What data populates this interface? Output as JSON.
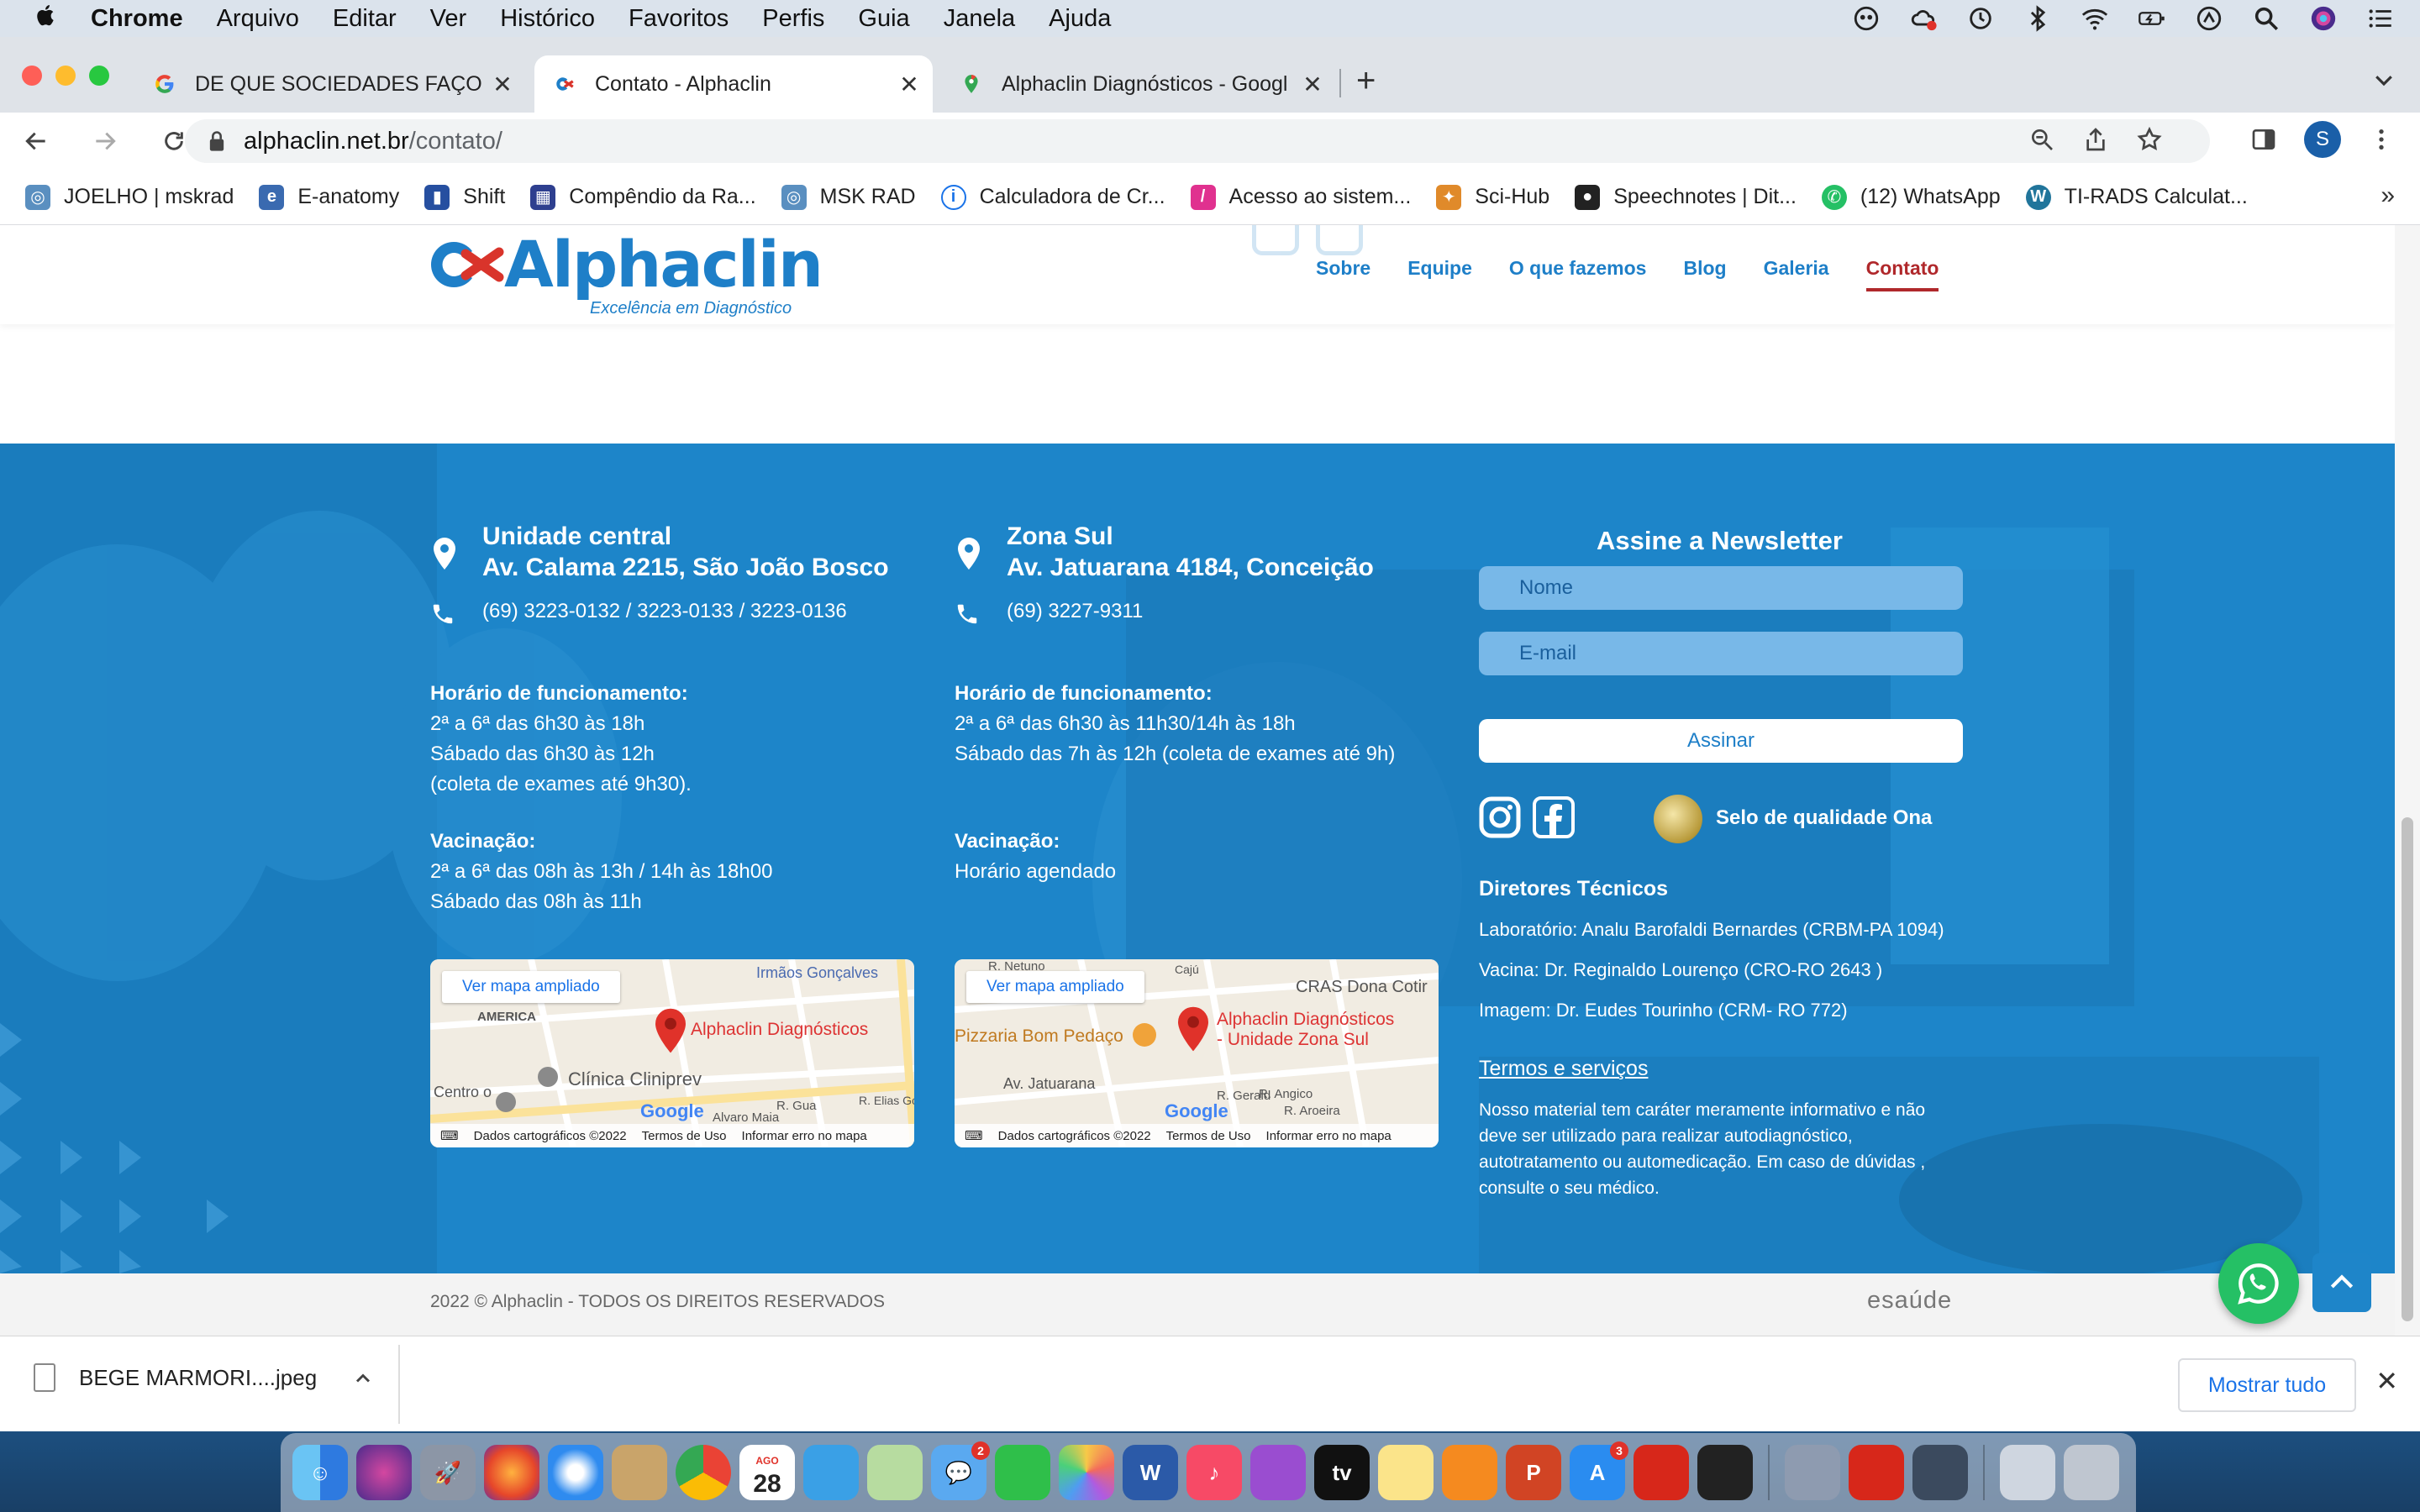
{
  "menubar": {
    "app": "Chrome",
    "items": [
      "Arquivo",
      "Editar",
      "Ver",
      "Histórico",
      "Favoritos",
      "Perfis",
      "Guia",
      "Janela",
      "Ajuda"
    ]
  },
  "tabs": [
    {
      "title": "DE QUE SOCIEDADES FAÇO PA",
      "favicon": "google-icon"
    },
    {
      "title": "Contato - Alphaclin",
      "favicon": "alphaclin-icon",
      "active": true
    },
    {
      "title": "Alphaclin Diagnósticos - Googl",
      "favicon": "google-maps-icon"
    }
  ],
  "address": {
    "host": "alphaclin.net.br",
    "path": "/contato/"
  },
  "profile_initial": "S",
  "bookmarks": [
    {
      "label": "JOELHO | mskrad",
      "icon": "mskrad-icon",
      "color": "#5a8fc0"
    },
    {
      "label": "E-anatomy",
      "icon": "e-anatomy-icon",
      "color": "#3a6ab0"
    },
    {
      "label": "Shift",
      "icon": "shift-icon",
      "color": "#264fa0"
    },
    {
      "label": "Compêndio da Ra...",
      "icon": "compendio-icon",
      "color": "#2e3f8f"
    },
    {
      "label": "MSK RAD",
      "icon": "msk-rad-icon",
      "color": "#5a8fc0"
    },
    {
      "label": "Calculadora de Cr...",
      "icon": "calculadora-icon",
      "color": "#1a73e8"
    },
    {
      "label": "Acesso ao sistem...",
      "icon": "acesso-icon",
      "color": "#e0318f"
    },
    {
      "label": "Sci-Hub",
      "icon": "sci-hub-icon",
      "color": "#e08a2a"
    },
    {
      "label": "Speechnotes | Dit...",
      "icon": "microphone-icon",
      "color": "#222222"
    },
    {
      "label": "(12) WhatsApp",
      "icon": "whatsapp-icon",
      "color": "#25c065"
    },
    {
      "label": "TI-RADS Calculat...",
      "icon": "wordpress-icon",
      "color": "#21759b"
    }
  ],
  "site": {
    "logo_name": "Alphaclin",
    "logo_tagline": "Excelência em Diagnóstico",
    "nav": [
      "Sobre",
      "Equipe",
      "O que fazemos",
      "Blog",
      "Galeria",
      "Contato"
    ],
    "nav_active": "Contato"
  },
  "footer": {
    "unit1": {
      "title1": "Unidade central",
      "title2": "Av. Calama 2215, São João Bosco",
      "phone": "(69) 3223-0132 / 3223-0133 / 3223-0136",
      "hours_title": "Horário de funcionamento:",
      "hours": [
        "2ª a 6ª das 6h30 às 18h",
        "Sábado das 6h30 às 12h",
        "(coleta de exames até 9h30)."
      ],
      "vac_title": "Vacinação:",
      "vac": [
        "2ª a 6ª das 08h às 13h / 14h às 18h00",
        "Sábado das 08h às 11h"
      ]
    },
    "unit2": {
      "title1": "Zona Sul",
      "title2": "Av. Jatuarana 4184, Conceição",
      "phone": "(69) 3227-9311",
      "hours_title": "Horário de funcionamento:",
      "hours": [
        "2ª a 6ª das 6h30 às 11h30/14h às 18h",
        "Sábado das 7h às 12h (coleta de exames até 9h)"
      ],
      "vac_title": "Vacinação:",
      "vac": [
        "Horário agendado"
      ]
    },
    "map1": {
      "button": "Ver mapa ampliado",
      "place": "Alphaclin Diagnósticos",
      "labels": [
        "Irmãos Gonçalves",
        "AMERICA",
        "Clínica Cliniprev",
        "Centro o",
        "Alvaro Maia",
        "R. Gua",
        "R. Elias Go"
      ],
      "footer": [
        "Dados cartográficos ©2022",
        "Termos de Uso",
        "Informar erro no mapa"
      ],
      "google": "Google"
    },
    "map2": {
      "button": "Ver mapa ampliado",
      "place_line1": "Alphaclin Diagnósticos",
      "place_line2": "- Unidade Zona Sul",
      "labels": [
        "R. Netuno",
        "CRAS Dona Cotir",
        "Pizzaria Bom Pedaço",
        "Av. Jatuarana",
        "R. Angico",
        "R. Aroeira",
        "R. Gerald",
        "Cajú"
      ],
      "footer": [
        "Dados cartográficos ©2022",
        "Termos de Uso",
        "Informar erro no mapa"
      ],
      "google": "Google"
    },
    "newsletter": {
      "title": "Assine a Newsletter",
      "name_placeholder": "Nome",
      "email_placeholder": "E-mail",
      "submit": "Assinar"
    },
    "seal": "Selo de qualidade Ona",
    "directors_title": "Diretores Técnicos",
    "directors": [
      "Laboratório: Analu Barofaldi Bernardes (CRBM-PA 1094)",
      "Vacina: Dr. Reginaldo Lourenço (CRO-RO 2643 )",
      "Imagem: Dr. Eudes Tourinho (CRM- RO 772)"
    ],
    "terms": "Termos e serviços",
    "disclaimer": "Nosso material tem caráter meramente informativo e não deve ser utilizado para realizar autodiagnóstico, autotratamento ou automedicação. Em caso de dúvidas , consulte o seu médico.",
    "copyright": "2022 © Alphaclin - TODOS OS DIREITOS RESERVADOS",
    "credit": "esaúde"
  },
  "download": {
    "filename": "BEGE MARMORI....jpeg",
    "show_all": "Mostrar tudo"
  },
  "dock": {
    "calendar_month": "AGO",
    "calendar_day": "28",
    "messages_badge": "2",
    "appstore_badge": "3"
  },
  "colors": {
    "brand": "#1e7fc8",
    "nav_active": "#b0282b",
    "footer_bg": "#1d85c9",
    "whatsapp": "#25c065"
  }
}
